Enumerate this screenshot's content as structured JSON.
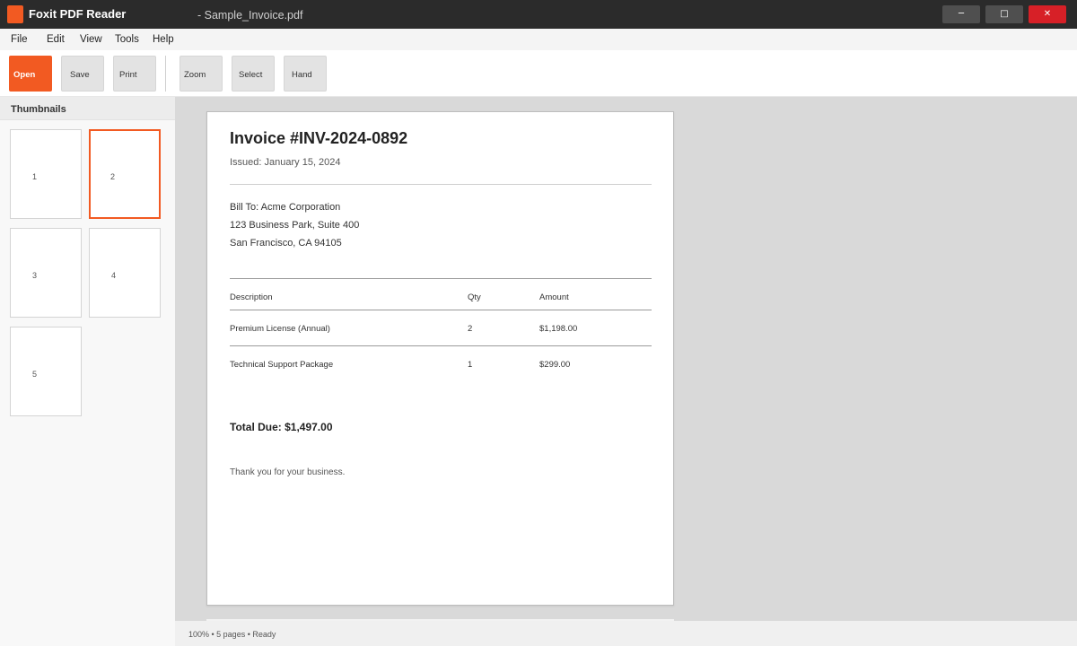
{
  "window": {
    "app_name": "Foxit PDF Reader",
    "document_title": "- Sample_Invoice.pdf",
    "controls": {
      "minimize_icon": "─",
      "maximize_icon": "□",
      "close_icon": "✕"
    },
    "colors": {
      "brand": "#f25a22",
      "titlebar": "#2b2b2b",
      "close": "#d72027"
    }
  },
  "menu": [
    "File",
    "Edit",
    "View",
    "Tools",
    "Help"
  ],
  "toolbar": {
    "open_label": "Open",
    "save_label": "Save",
    "print_label": "Print",
    "zoom_label": "Zoom",
    "select_label": "Select",
    "hand_label": "Hand"
  },
  "sidebar": {
    "title": "Thumbnails",
    "thumbnails": [
      "1",
      "2",
      "3",
      "4",
      "5"
    ],
    "active_page": "2"
  },
  "document": {
    "title": "Invoice #INV-2024-0892",
    "issued": "Issued: January 15, 2024",
    "bill_to": [
      "Bill To: Acme Corporation",
      "123 Business Park, Suite 400",
      "San Francisco, CA 94105"
    ],
    "table": {
      "headers": [
        "Description",
        "Qty",
        "Amount"
      ],
      "rows": [
        [
          "Premium License (Annual)",
          "2",
          "$1,198.00"
        ],
        [
          "Technical Support Package",
          "1",
          "$299.00"
        ]
      ]
    },
    "total": "Total Due: $1,497.00",
    "footer": "Thank you for your business."
  },
  "status": "100% • 5 pages • Ready"
}
